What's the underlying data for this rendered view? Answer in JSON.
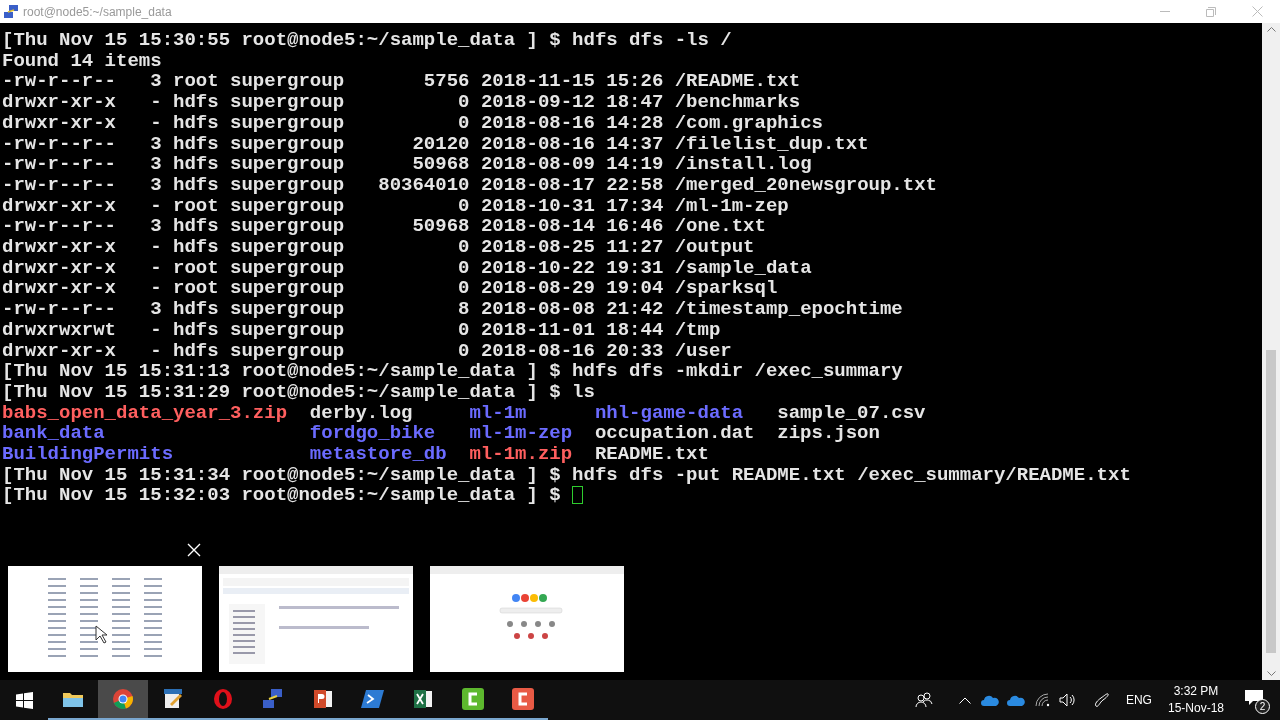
{
  "window": {
    "title": "root@node5:~/sample_data"
  },
  "terminal": {
    "lines": [
      {
        "kind": "text",
        "text": "[Thu Nov 15 15:30:55 root@node5:~/sample_data ] $ hdfs dfs -ls /"
      },
      {
        "kind": "text",
        "text": "Found 14 items"
      },
      {
        "kind": "text",
        "text": "-rw-r--r--   3 root supergroup       5756 2018-11-15 15:26 /README.txt"
      },
      {
        "kind": "text",
        "text": "drwxr-xr-x   - hdfs supergroup          0 2018-09-12 18:47 /benchmarks"
      },
      {
        "kind": "text",
        "text": "drwxr-xr-x   - hdfs supergroup          0 2018-08-16 14:28 /com.graphics"
      },
      {
        "kind": "text",
        "text": "-rw-r--r--   3 hdfs supergroup      20120 2018-08-16 14:37 /filelist_dup.txt"
      },
      {
        "kind": "text",
        "text": "-rw-r--r--   3 hdfs supergroup      50968 2018-08-09 14:19 /install.log"
      },
      {
        "kind": "text",
        "text": "-rw-r--r--   3 hdfs supergroup   80364010 2018-08-17 22:58 /merged_20newsgroup.txt"
      },
      {
        "kind": "text",
        "text": "drwxr-xr-x   - root supergroup          0 2018-10-31 17:34 /ml-1m-zep"
      },
      {
        "kind": "text",
        "text": "-rw-r--r--   3 hdfs supergroup      50968 2018-08-14 16:46 /one.txt"
      },
      {
        "kind": "text",
        "text": "drwxr-xr-x   - hdfs supergroup          0 2018-08-25 11:27 /output"
      },
      {
        "kind": "text",
        "text": "drwxr-xr-x   - root supergroup          0 2018-10-22 19:31 /sample_data"
      },
      {
        "kind": "text",
        "text": "drwxr-xr-x   - root supergroup          0 2018-08-29 19:04 /sparksql"
      },
      {
        "kind": "text",
        "text": "-rw-r--r--   3 hdfs supergroup          8 2018-08-08 21:42 /timestamp_epochtime"
      },
      {
        "kind": "text",
        "text": "drwxrwxrwt   - hdfs supergroup          0 2018-11-01 18:44 /tmp"
      },
      {
        "kind": "text",
        "text": "drwxr-xr-x   - hdfs supergroup          0 2018-08-16 20:33 /user"
      },
      {
        "kind": "text",
        "text": "[Thu Nov 15 15:31:13 root@node5:~/sample_data ] $ hdfs dfs -mkdir /exec_summary"
      },
      {
        "kind": "text",
        "text": "[Thu Nov 15 15:31:29 root@node5:~/sample_data ] $ ls"
      },
      {
        "kind": "listing",
        "entries": [
          {
            "text": "babs_open_data_year_3.zip",
            "kind": "archive"
          },
          {
            "text": "derby.log",
            "kind": "file"
          },
          {
            "text": "ml-1m",
            "kind": "directory"
          },
          {
            "text": "nhl-game-data",
            "kind": "directory"
          },
          {
            "text": "sample_07.csv",
            "kind": "file"
          }
        ]
      },
      {
        "kind": "listing",
        "entries": [
          {
            "text": "bank_data",
            "kind": "directory"
          },
          {
            "text": "fordgo_bike",
            "kind": "directory"
          },
          {
            "text": "ml-1m-zep",
            "kind": "directory"
          },
          {
            "text": "occupation.dat",
            "kind": "file"
          },
          {
            "text": "zips.json",
            "kind": "file"
          }
        ]
      },
      {
        "kind": "listing",
        "entries": [
          {
            "text": "BuildingPermits",
            "kind": "directory"
          },
          {
            "text": "metastore_db",
            "kind": "directory"
          },
          {
            "text": "ml-1m.zip",
            "kind": "archive"
          },
          {
            "text": "README.txt",
            "kind": "file"
          }
        ]
      },
      {
        "kind": "text",
        "text": "[Thu Nov 15 15:31:34 root@node5:~/sample_data ] $ hdfs dfs -put README.txt /exec_summary/README.txt"
      },
      {
        "kind": "prompt",
        "text": "[Thu Nov 15 15:32:03 root@node5:~/sample_data ] $ "
      }
    ]
  },
  "thumbnails": [
    {
      "kind": "list"
    },
    {
      "kind": "settings"
    },
    {
      "kind": "search"
    }
  ],
  "taskbar": {
    "apps": [
      {
        "kind": "folder",
        "selected": false
      },
      {
        "kind": "chrome",
        "selected": true
      },
      {
        "kind": "editor",
        "selected": false
      },
      {
        "kind": "opera",
        "selected": false
      },
      {
        "kind": "network",
        "selected": false
      },
      {
        "kind": "powerpoint",
        "selected": false
      },
      {
        "kind": "powershell",
        "selected": false
      },
      {
        "kind": "excel",
        "selected": false
      },
      {
        "kind": "camtasia",
        "selected": false
      },
      {
        "kind": "recorder",
        "selected": false
      }
    ],
    "language": "ENG",
    "time": "3:32 PM",
    "date": "15-Nov-18",
    "notifications": "2"
  }
}
